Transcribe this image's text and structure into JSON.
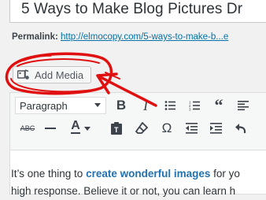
{
  "post": {
    "title": "5 Ways to Make Blog Pictures Dr",
    "permalink_label": "Permalink:",
    "permalink_url": "http://elmocopy.com/5-ways-to-make-b...e"
  },
  "media": {
    "add_media_label": "Add Media"
  },
  "toolbar": {
    "format_select_value": "Paragraph",
    "row1_icons": [
      "bold-icon",
      "italic-icon",
      "bulleted-list-icon",
      "numbered-list-icon",
      "blockquote-icon",
      "align-left-icon"
    ],
    "row2_icons": [
      "strikethrough-icon",
      "horizontal-line-icon",
      "text-color-icon",
      "paste-as-text-icon",
      "clear-formatting-icon",
      "special-character-icon",
      "decrease-indent-icon",
      "increase-indent-icon",
      "undo-icon"
    ]
  },
  "content": {
    "line1_before": "It’s one thing to ",
    "line1_link": "create wonderful images",
    "line1_after": " for yo",
    "line2": "high response.  Believe it or not, you can learn h"
  },
  "colors": {
    "annotation_red": "#e01010",
    "link_blue": "#0073aa"
  }
}
